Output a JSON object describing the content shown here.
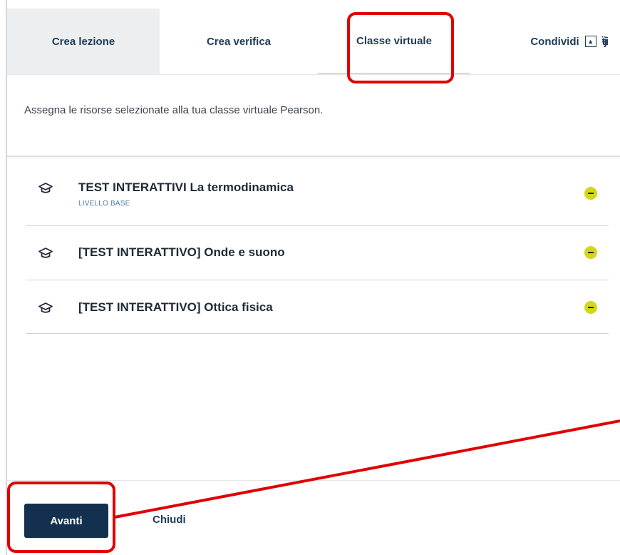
{
  "tabs": [
    {
      "label": "Crea lezione"
    },
    {
      "label": "Crea verifica"
    },
    {
      "label": "Classe virtuale"
    },
    {
      "label": "Condividi"
    }
  ],
  "description": "Assegna le risorse selezionate alla tua classe virtuale Pearson.",
  "items": [
    {
      "title": "TEST INTERATTIVI La termodinamica",
      "subtitle": "LIVELLO BASE"
    },
    {
      "title": "[TEST INTERATTIVO] Onde e suono"
    },
    {
      "title": "[TEST INTERATTIVO] Ottica fisica"
    }
  ],
  "footer": {
    "primary_label": "Avanti",
    "secondary_label": "Chiudi"
  },
  "icons": {
    "share": "share-icon",
    "teams": "teams-icon",
    "item": "graduation-cap-icon",
    "remove": "remove-circle-icon"
  },
  "colors": {
    "primary_button": "#13314f",
    "tab_text": "#1e3b57",
    "remove_icon": "#d4d61c",
    "annotation": "#e00000",
    "active_tab_underline": "#f0dc96"
  }
}
